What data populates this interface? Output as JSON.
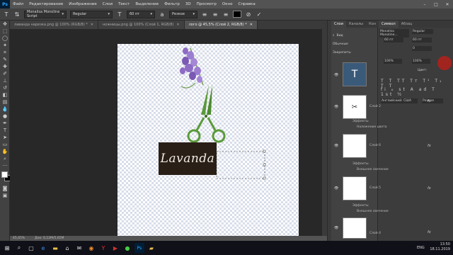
{
  "app": {
    "logo": "Ps"
  },
  "menu": [
    "Файл",
    "Редактирование",
    "Изображение",
    "Слои",
    "Текст",
    "Выделение",
    "Фильтр",
    "3D",
    "Просмотр",
    "Окно",
    "Справка"
  ],
  "options": {
    "font_family": "Monalisa Monoline Script",
    "font_style": "Regular",
    "font_size": "60 пт",
    "antialias": "Резкое",
    "text_color": "#000000"
  },
  "tabs": [
    {
      "label": "лаванда нарезка.png @ 100% (RGB/8) *",
      "active": false
    },
    {
      "label": "ножницы.png @ 100% (Слой 1, RGB/8)",
      "active": false
    },
    {
      "label": "лого @ 45,5% (Слой 2, RGB/8) *",
      "active": true
    }
  ],
  "canvas": {
    "logo_text": "Lavanda",
    "lavender_color": "#8e6cc3",
    "scissors_color": "#5a9a3a",
    "logo_bg": "#2a1f17"
  },
  "status": {
    "zoom": "45,45%",
    "doc": "Док: 6,12M/5,65M"
  },
  "panel_tabs": [
    "Слои",
    "Каналы",
    "Кон",
    "Символ",
    "Абзац"
  ],
  "layers_panel": {
    "search_placeholder": "Вид",
    "blend": "Обычные",
    "opacity_label": "Непрозр.:",
    "lock_label": "Закрепить:"
  },
  "layers": [
    {
      "name": "Слой 2",
      "effects": "Эффекты",
      "effect_item": "Наложение цвета",
      "fx": "fx"
    },
    {
      "name": "Слой 6",
      "effects": "Эффекты",
      "effect_item": "Внешнее свечение",
      "fx": "fx"
    },
    {
      "name": "Слой 5",
      "effects": "Эффекты",
      "effect_item": "Внешнее свечение",
      "fx": "fx"
    },
    {
      "name": "Слой 4",
      "fx": "fx"
    }
  ],
  "char_panel": {
    "font": "Monalisa Monoline...",
    "style": "Regular",
    "size": "60 пт",
    "leading": "60 пт",
    "tracking": "0",
    "scale_v": "100%",
    "scale_h": "100%",
    "color_label": "Цвет:",
    "language": "Английский: США",
    "aa": "Резкое"
  },
  "tray": {
    "lang": "ENG",
    "time": "13:50",
    "date": "18.11.2019"
  }
}
